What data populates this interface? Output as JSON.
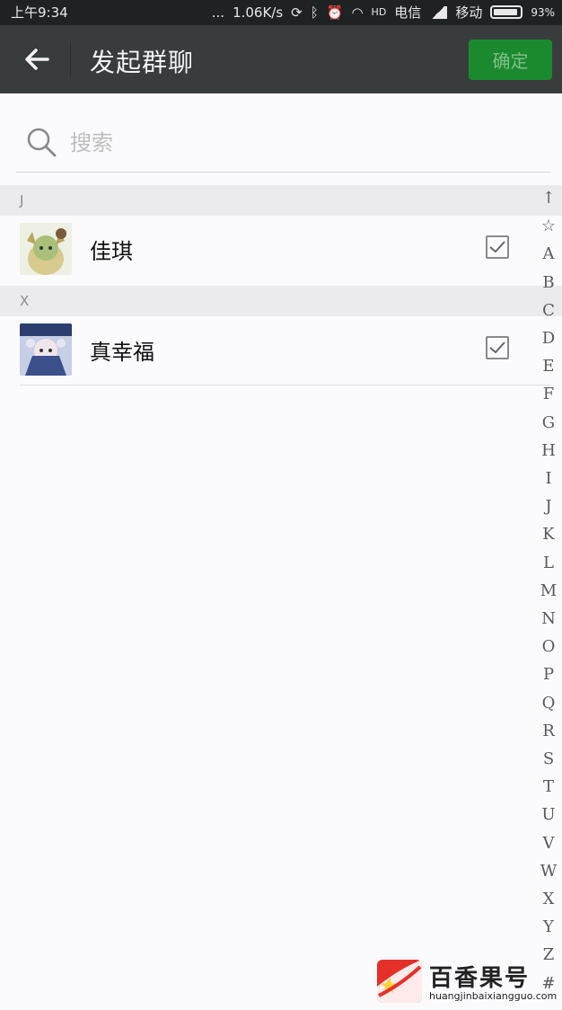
{
  "status_bar": {
    "time": "上午9:34",
    "dots": "...",
    "speed": "1.06K/s",
    "hd": "HD",
    "carrier1": "电信",
    "carrier2": "移动",
    "battery_percent": "93%",
    "battery_level": 0.93
  },
  "header": {
    "title": "发起群聊",
    "confirm_label": "确定",
    "confirm_bg": "#1b8a2f"
  },
  "search": {
    "placeholder": "搜索"
  },
  "sections": [
    {
      "letter": "J",
      "contacts": [
        {
          "name": "佳琪",
          "checked": true
        }
      ]
    },
    {
      "letter": "X",
      "contacts": [
        {
          "name": "真幸福",
          "checked": true
        }
      ]
    }
  ],
  "index_bar": [
    "↑",
    "☆",
    "A",
    "B",
    "C",
    "D",
    "E",
    "F",
    "G",
    "H",
    "I",
    "J",
    "K",
    "L",
    "M",
    "N",
    "O",
    "P",
    "Q",
    "R",
    "S",
    "T",
    "U",
    "V",
    "W",
    "X",
    "Y",
    "Z",
    "#"
  ],
  "watermark": {
    "title": "百香果号",
    "url": "huangjinbaixiangguo.com"
  },
  "colors": {
    "title_bar": "#383c3d",
    "status_bar": "#1f2223",
    "accent": "#1b8a2f"
  }
}
